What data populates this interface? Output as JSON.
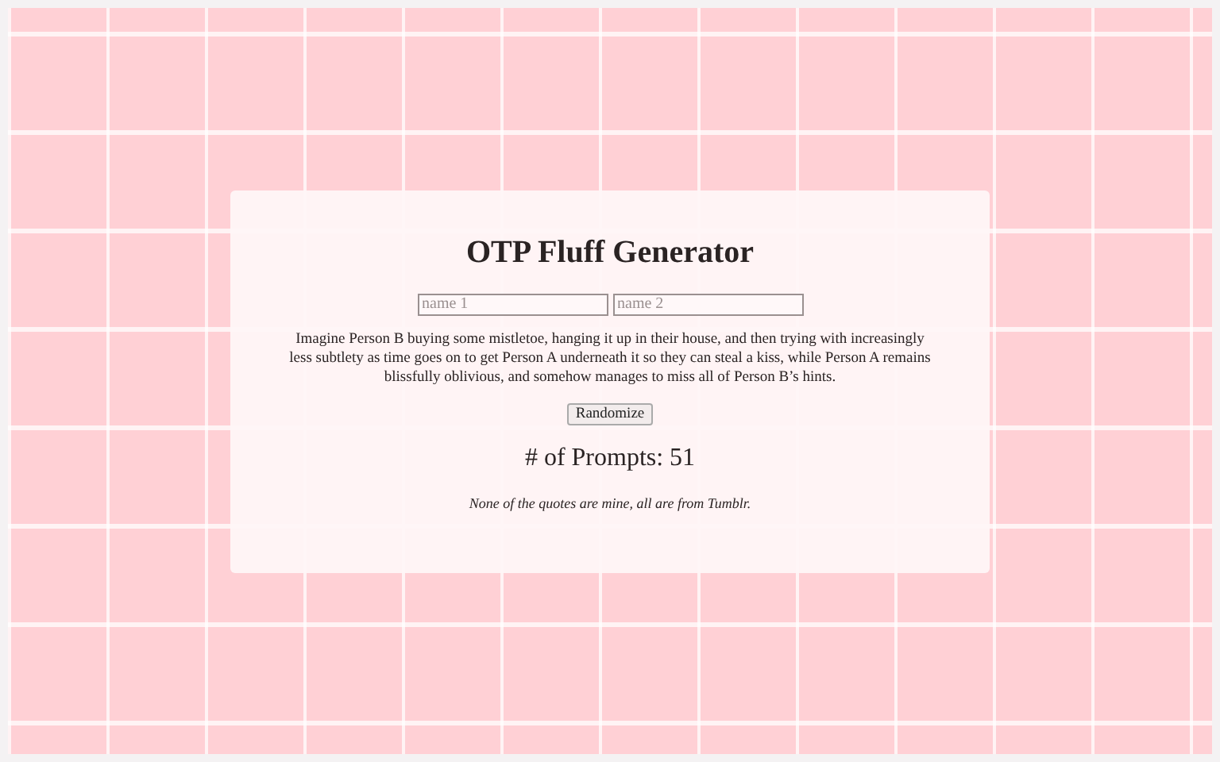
{
  "title": "OTP Fluff Generator",
  "fields": [
    {
      "placeholder": "name 1"
    },
    {
      "placeholder": "name 2"
    }
  ],
  "prompt": "Imagine Person B buying some mistletoe, hanging it up in their house, and then trying with increasingly less subtlety as time goes on to get Person A underneath it so they can steal a kiss, while Person A remains blissfully oblivious, and somehow manages to miss all of Person B’s hints.",
  "button": "Randomize",
  "count": "# of Prompts: 51",
  "note": "None of the quotes are mine, all are from Tumblr."
}
